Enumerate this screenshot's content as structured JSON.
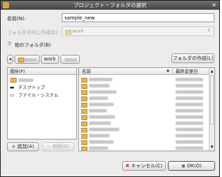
{
  "window": {
    "title": "プロジェクト・フォルダの選択"
  },
  "name_field": {
    "label": "名前(N):",
    "value": "sample_new"
  },
  "create_in": {
    "label": "フォルダの中に作成(E):",
    "value": "work"
  },
  "other_folders": {
    "label": "他のフォルダ(B)"
  },
  "path_bar": {
    "segments": [
      "",
      "work",
      ""
    ]
  },
  "create_folder_button": {
    "label": "フォルダの作成(L)"
  },
  "places": {
    "header": "場所(P)",
    "items": [
      {
        "icon": "home-folder-icon",
        "label": ""
      },
      {
        "icon": "desktop-icon",
        "label": "デスクトップ"
      },
      {
        "icon": "drive-icon",
        "label": "ファイル・システム"
      }
    ]
  },
  "add_button": {
    "label": "追加(A)"
  },
  "remove_button": {
    "label": "削除(R)"
  },
  "files": {
    "col_name": "名前",
    "col_modified": "最終変更日",
    "row_count": 12
  },
  "cancel_button": {
    "label": "キャンセル(C)"
  },
  "ok_button": {
    "label": "OK(O)"
  },
  "colors": {
    "accent": "#7a9ccf",
    "folder": "#e2b55a"
  }
}
